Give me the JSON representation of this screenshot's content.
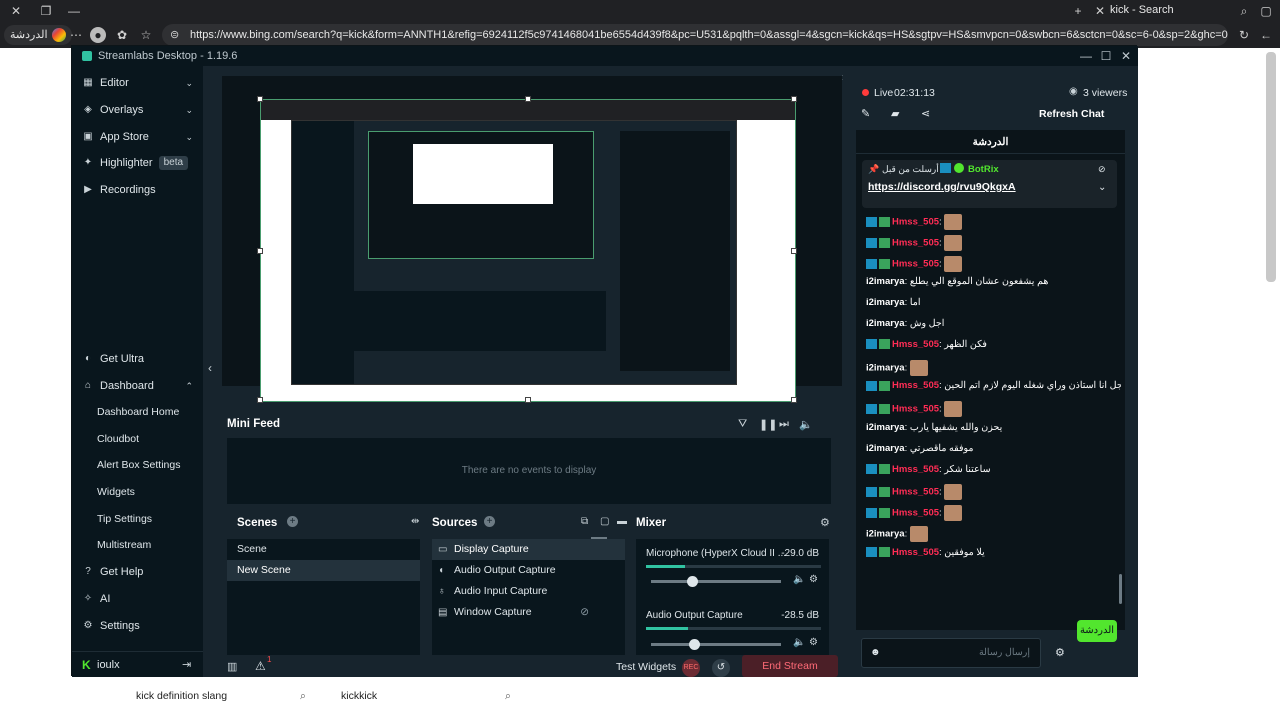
{
  "browser": {
    "tab_title": "kick - Search",
    "profile_label": "الدردشة",
    "url": "https://www.bing.com/search?q=kick&form=ANNTH1&refig=6924112f5c9741468041be6554d439f8&pc=U531&pqlth=0&assgl=4&sgcn=kick&qs=HS&sgtpv=HS&smvpcn=0&swbcn=6&sctcn=0&sc=6-0&sp=2&ghc=0&cvid=6924112f5c97414..."
  },
  "app": {
    "title": "Streamlabs Desktop - 1.19.6"
  },
  "nav": {
    "editor": "Editor",
    "overlays": "Overlays",
    "app_store": "App Store",
    "highlighter": "Highlighter",
    "beta": "beta",
    "recordings": "Recordings",
    "get_ultra": "Get Ultra",
    "dashboard": "Dashboard",
    "dashboard_home": "Dashboard Home",
    "cloudbot": "Cloudbot",
    "alert_box": "Alert Box Settings",
    "widgets": "Widgets",
    "tip_settings": "Tip Settings",
    "multistream": "Multistream",
    "get_help": "Get Help",
    "ai": "AI",
    "settings": "Settings",
    "username": "ioulx"
  },
  "mini_feed": {
    "title": "Mini Feed",
    "empty": "There are no events to display"
  },
  "scenes": {
    "title": "Scenes",
    "items": [
      "Scene",
      "New Scene"
    ]
  },
  "sources": {
    "title": "Sources",
    "items": [
      "Display Capture",
      "Audio Output Capture",
      "Audio Input Capture",
      "Window Capture"
    ]
  },
  "mixer": {
    "title": "Mixer",
    "channels": [
      {
        "name": "Microphone (HyperX Cloud II ...",
        "db": "-29.0 dB",
        "level": 0.22,
        "volume": 0.3
      },
      {
        "name": "Audio Output Capture",
        "db": "-28.5 dB",
        "level": 0.24,
        "volume": 0.32
      }
    ]
  },
  "footer": {
    "test_widgets": "Test Widgets",
    "end_stream": "End Stream",
    "notif_count": "1"
  },
  "chat": {
    "live_label": "Live",
    "live_time": "02:31:13",
    "viewers": "3 viewers",
    "refresh": "Refresh Chat",
    "header": "الدردشة",
    "pinned_user": "BotRix",
    "pinned_prefix": "أرسلت من قبل",
    "pinned_link": "https://discord.gg/rvu9QkgxA",
    "input_placeholder": "إرسال رسالة",
    "send": "الدردشة",
    "messages": [
      {
        "user": "Hmss_505",
        "text": "",
        "color": "red",
        "badges": true
      },
      {
        "user": "Hmss_505",
        "text": "",
        "color": "red",
        "badges": true
      },
      {
        "user": "Hmss_505",
        "text": "",
        "color": "red",
        "badges": true
      },
      {
        "user": "i2imarya",
        "text": "هم يشفعون عشان الموقع الي يطلع",
        "color": "white",
        "badges": false
      },
      {
        "user": "i2imarya",
        "text": "اما",
        "color": "white",
        "badges": false
      },
      {
        "user": "i2imarya",
        "text": "اجل وش",
        "color": "white",
        "badges": false
      },
      {
        "user": "Hmss_505",
        "text": "فكن الظهر",
        "color": "red",
        "badges": true
      },
      {
        "user": "i2imarya",
        "text": "",
        "color": "white",
        "badges": false
      },
      {
        "user": "Hmss_505",
        "text": "يلا اجل انا استاذن وراي شغله اليوم لازم اتم الحين",
        "color": "red",
        "badges": true
      },
      {
        "user": "Hmss_505",
        "text": "",
        "color": "red",
        "badges": true
      },
      {
        "user": "i2imarya",
        "text": "يحزن والله يشفيها يارب",
        "color": "white",
        "badges": false
      },
      {
        "user": "i2imarya",
        "text": "موفقه ماقصرتي",
        "color": "white",
        "badges": false
      },
      {
        "user": "Hmss_505",
        "text": "ساعتنا شكر",
        "color": "red",
        "badges": true
      },
      {
        "user": "Hmss_505",
        "text": "",
        "color": "red",
        "badges": true
      },
      {
        "user": "Hmss_505",
        "text": "",
        "color": "red",
        "badges": true
      },
      {
        "user": "i2imarya",
        "text": "",
        "color": "white",
        "badges": false
      },
      {
        "user": "Hmss_505",
        "text": "يلا موفقين",
        "color": "red",
        "badges": true
      }
    ]
  },
  "search_chips": [
    "kick definition slang",
    "kickkick"
  ]
}
